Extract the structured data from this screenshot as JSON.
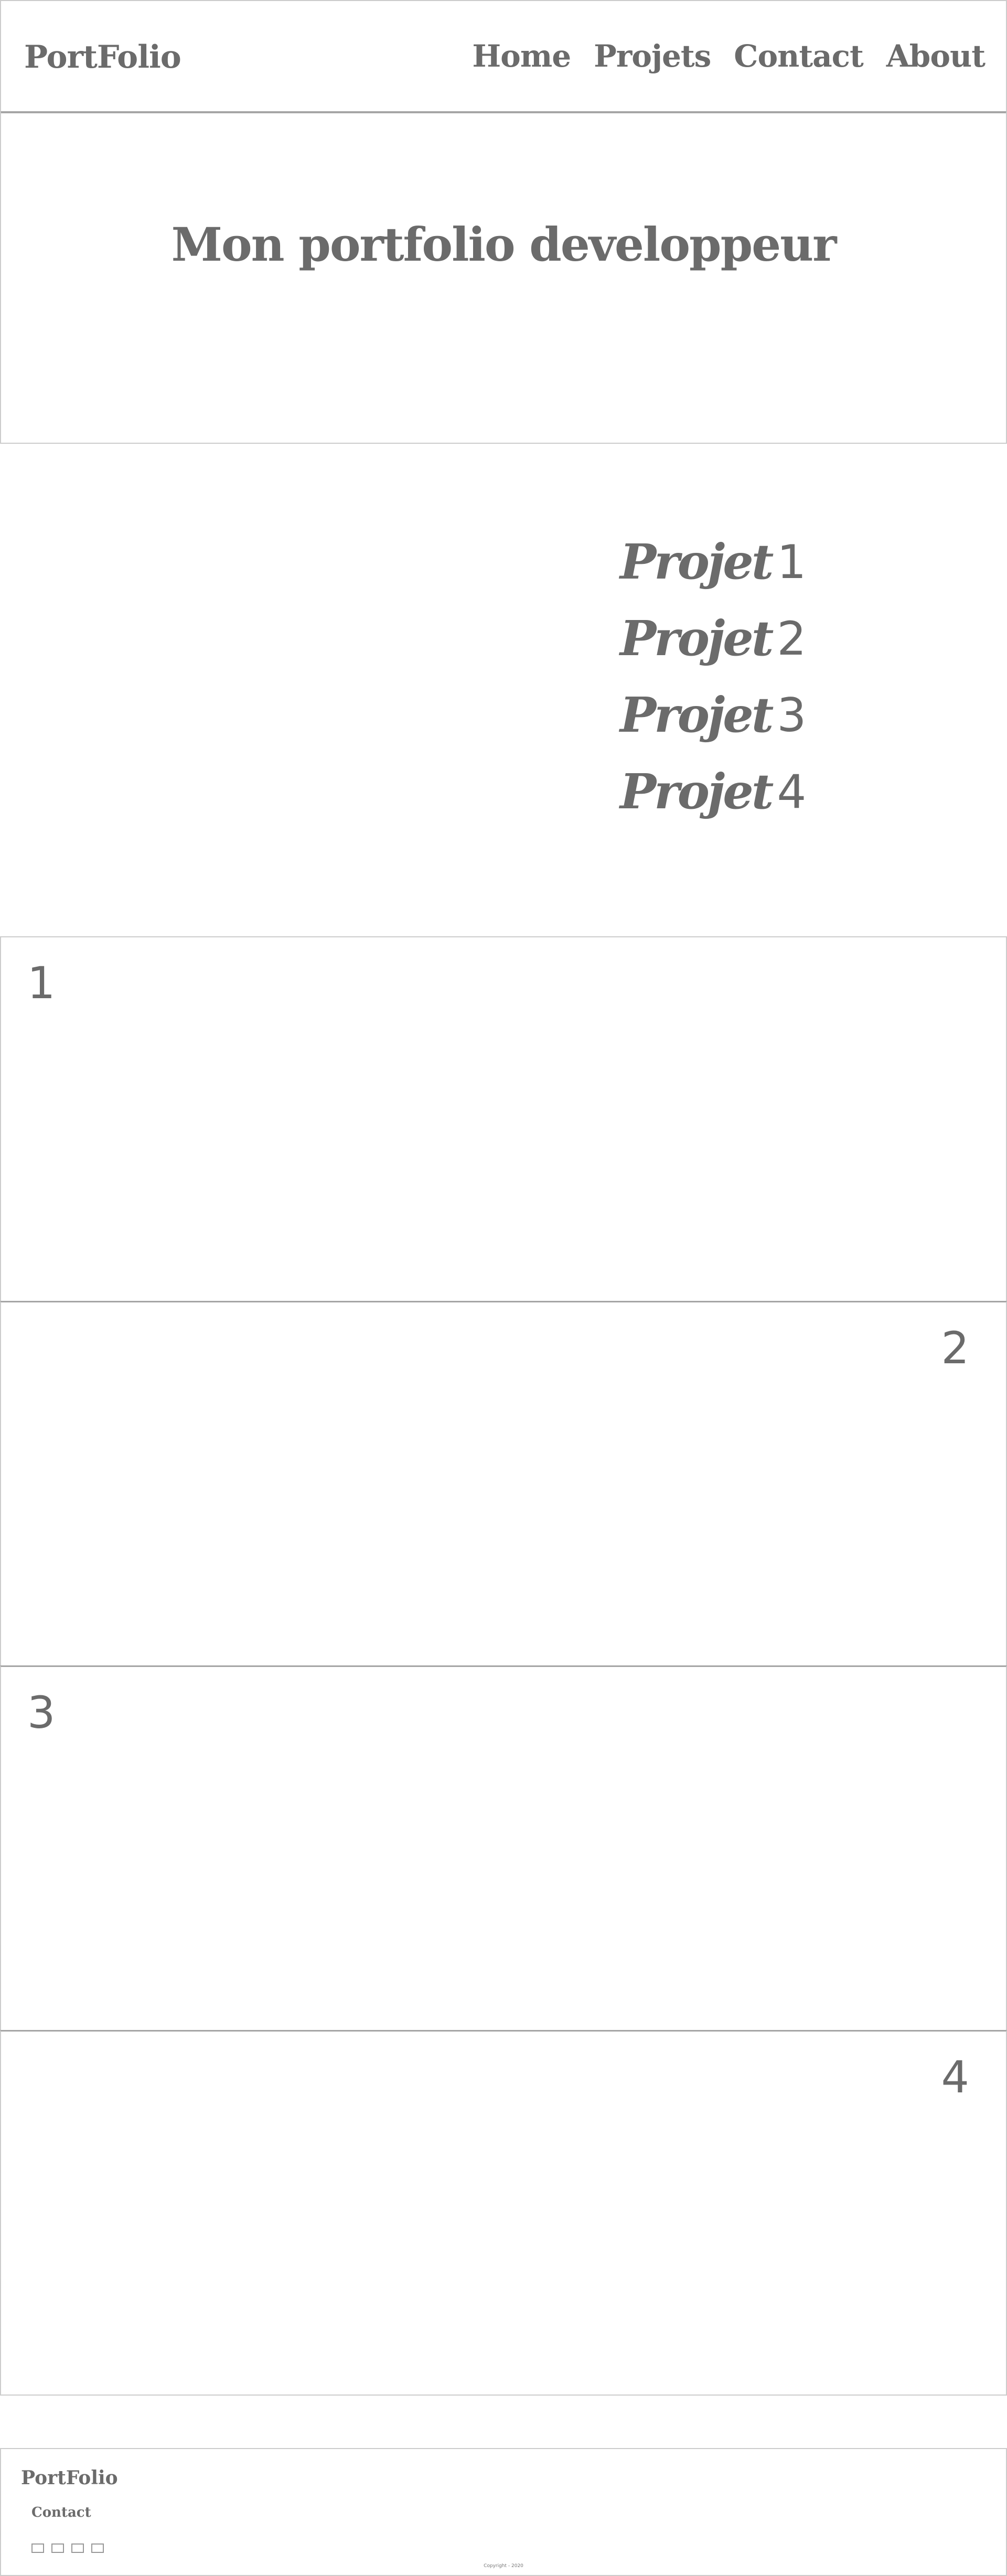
{
  "header": {
    "brand": "PortFolio",
    "nav": [
      "Home",
      "Projets",
      "Contact",
      "About"
    ]
  },
  "hero": {
    "title": "Mon portfolio developpeur"
  },
  "project_list": [
    {
      "word": "Projet",
      "num": "1"
    },
    {
      "word": "Projet",
      "num": "2"
    },
    {
      "word": "Projet",
      "num": "3"
    },
    {
      "word": "Projet",
      "num": "4"
    }
  ],
  "projects": [
    {
      "num": "1"
    },
    {
      "num": "2"
    },
    {
      "num": "3"
    },
    {
      "num": "4"
    }
  ],
  "footer": {
    "brand": "PortFolio",
    "contact_label": "Contact",
    "social_icons": [
      "social-icon-1",
      "social-icon-2",
      "social-icon-3",
      "social-icon-4"
    ],
    "copyright": "Copyright - 2020"
  },
  "colors": {
    "text": "#6b6b6b",
    "border": "#cccccc",
    "divider": "#a5a5a5",
    "background": "#ffffff"
  }
}
